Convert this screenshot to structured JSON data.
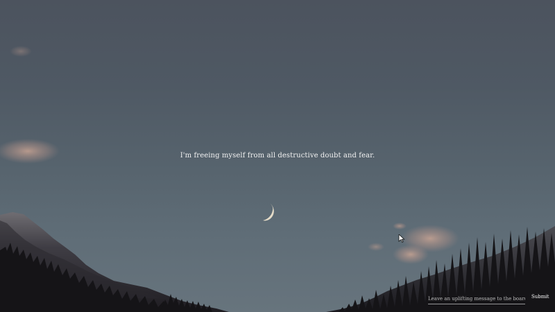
{
  "quote": {
    "text": "I'm freeing myself from all destructive doubt and fear."
  },
  "board": {
    "placeholder": "Leave an uplifting message to the board...",
    "input_value": "",
    "submit_label": "Submit"
  },
  "scene": {
    "sky_top_color": "#4c535e",
    "sky_bottom_color": "#67747d",
    "moon_color": "#e5dcc8",
    "cloud_color": "#c9a89a",
    "trees_color": "#151417"
  },
  "icons": {
    "cursor": "mouse-pointer-icon",
    "moon": "crescent-moon-icon"
  }
}
